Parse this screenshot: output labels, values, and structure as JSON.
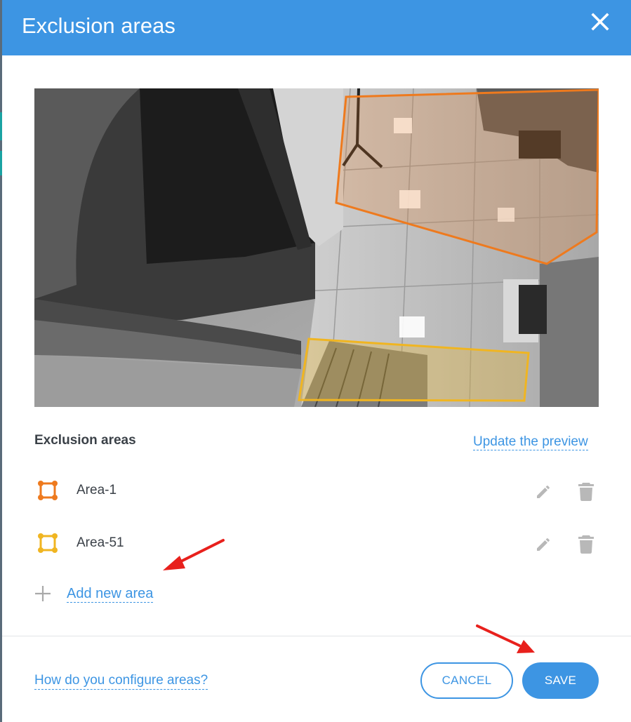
{
  "dialog": {
    "title": "Exclusion areas",
    "close_icon": "close-icon"
  },
  "preview": {
    "description_icon": "camera-fisheye-preview",
    "areas_drawn": [
      {
        "name": "Area-1",
        "color": "#ee7a1e"
      },
      {
        "name": "Area-51",
        "color": "#f0b521"
      }
    ]
  },
  "areas_section": {
    "title": "Exclusion areas",
    "update_preview_label": "Update the preview",
    "items": [
      {
        "name": "Area-1",
        "color": "#ee7a1e",
        "edit_icon": "pencil-icon",
        "delete_icon": "trash-icon"
      },
      {
        "name": "Area-51",
        "color": "#f0b521",
        "edit_icon": "pencil-icon",
        "delete_icon": "trash-icon"
      }
    ],
    "add_label": "Add new area",
    "add_icon": "plus-icon"
  },
  "footer": {
    "help_label": "How do you configure areas?",
    "cancel_label": "CANCEL",
    "save_label": "SAVE"
  },
  "colors": {
    "accent": "#3d95e3",
    "area1": "#ee7a1e",
    "area51": "#f0b521",
    "annotation_arrow": "#e8201c"
  }
}
